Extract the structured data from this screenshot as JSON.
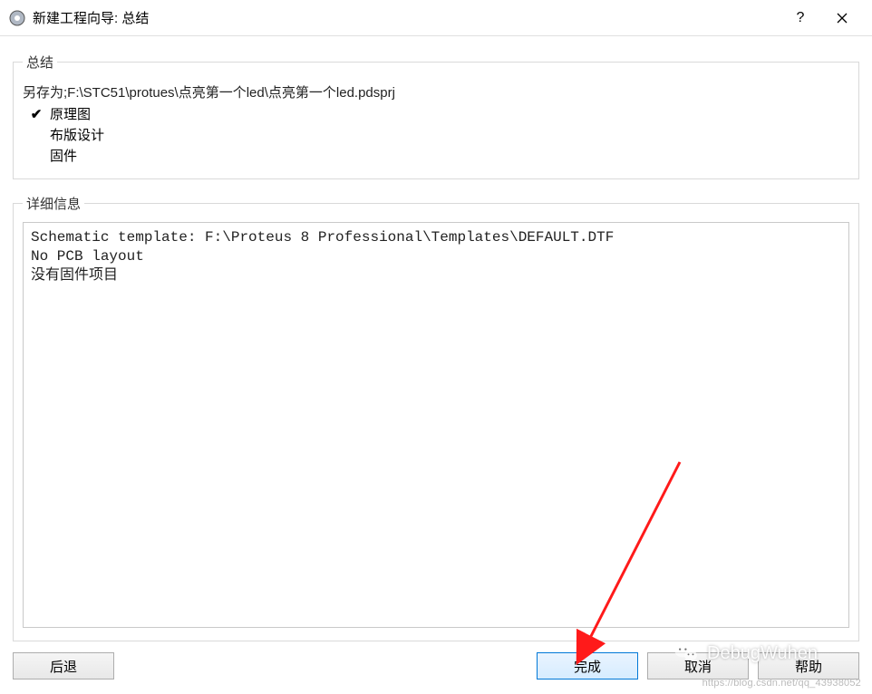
{
  "window": {
    "title": "新建工程向导: 总结"
  },
  "summary": {
    "legend": "总结",
    "saveAsLine": "另存为;F:\\STC51\\protues\\点亮第一个led\\点亮第一个led.pdsprj",
    "items": [
      {
        "checked": true,
        "label": "原理图"
      },
      {
        "checked": false,
        "label": "布版设计"
      },
      {
        "checked": false,
        "label": "固件"
      }
    ]
  },
  "details": {
    "legend": "详细信息",
    "lines": [
      "Schematic template: F:\\Proteus 8 Professional\\Templates\\DEFAULT.DTF",
      "No PCB layout",
      "没有固件项目"
    ]
  },
  "footer": {
    "back": "后退",
    "finish": "完成",
    "cancel": "取消",
    "help": "帮助"
  },
  "watermark": {
    "brand": "DebugWuhen",
    "url": "https://blog.csdn.net/qq_43938052"
  }
}
